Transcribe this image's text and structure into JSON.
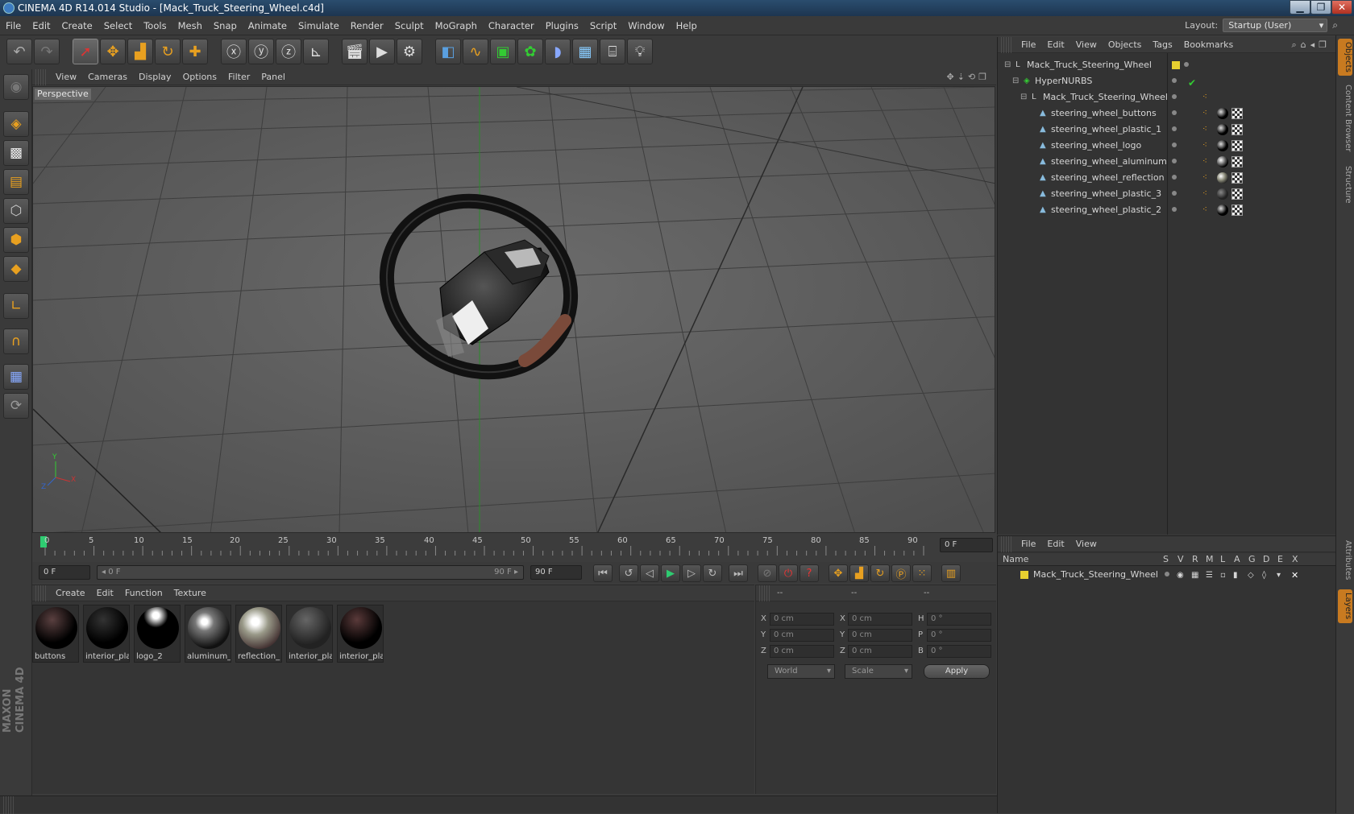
{
  "window": {
    "title": "CINEMA 4D R14.014 Studio - [Mack_Truck_Steering_Wheel.c4d]",
    "min": "▁",
    "max": "❐",
    "close": "✕"
  },
  "menu": [
    "File",
    "Edit",
    "Create",
    "Select",
    "Tools",
    "Mesh",
    "Snap",
    "Animate",
    "Simulate",
    "Render",
    "Sculpt",
    "MoGraph",
    "Character",
    "Plugins",
    "Script",
    "Window",
    "Help"
  ],
  "layout": {
    "label": "Layout:",
    "value": "Startup (User)"
  },
  "viewport": {
    "menu": [
      "View",
      "Cameras",
      "Display",
      "Options",
      "Filter",
      "Panel"
    ],
    "label": "Perspective",
    "axis": {
      "y": "Y",
      "x": "X",
      "z": "Z"
    }
  },
  "timeline": {
    "ticks": [
      "0",
      "5",
      "10",
      "15",
      "20",
      "25",
      "30",
      "35",
      "40",
      "45",
      "50",
      "55",
      "60",
      "65",
      "70",
      "75",
      "80",
      "85",
      "90"
    ],
    "current_frame": "0 F",
    "start_field": "0 F",
    "range_start": "◂ 0 F",
    "range_end": "90 F ▸",
    "end_field": "90 F"
  },
  "materials": {
    "menu": [
      "Create",
      "Edit",
      "Function",
      "Texture"
    ],
    "items": [
      {
        "label": "buttons"
      },
      {
        "label": "interior_pla"
      },
      {
        "label": "logo_2"
      },
      {
        "label": "aluminum_"
      },
      {
        "label": "reflection_"
      },
      {
        "label": "interior_pla"
      },
      {
        "label": "interior_pla"
      }
    ]
  },
  "coords": {
    "headers": [
      "--",
      "--",
      "--"
    ],
    "rows": [
      {
        "a": "X",
        "av": "0 cm",
        "b": "X",
        "bv": "0 cm",
        "c": "H",
        "cv": "0 °"
      },
      {
        "a": "Y",
        "av": "0 cm",
        "b": "Y",
        "bv": "0 cm",
        "c": "P",
        "cv": "0 °"
      },
      {
        "a": "Z",
        "av": "0 cm",
        "b": "Z",
        "bv": "0 cm",
        "c": "B",
        "cv": "0 °"
      }
    ],
    "mode": "World",
    "type": "Scale",
    "apply": "Apply"
  },
  "objects": {
    "menu": [
      "File",
      "Edit",
      "View",
      "Objects",
      "Tags",
      "Bookmarks"
    ],
    "items": [
      {
        "name": "Mack_Truck_Steering_Wheel"
      },
      {
        "name": "HyperNURBS"
      },
      {
        "name": "Mack_Truck_Steering_Wheel"
      },
      {
        "name": "steering_wheel_buttons"
      },
      {
        "name": "steering_wheel_plastic_1"
      },
      {
        "name": "steering_wheel_logo"
      },
      {
        "name": "steering_wheel_aluminum"
      },
      {
        "name": "steering_wheel_reflection"
      },
      {
        "name": "steering_wheel_plastic_3"
      },
      {
        "name": "steering_wheel_plastic_2"
      }
    ]
  },
  "layers": {
    "menu": [
      "File",
      "Edit",
      "View"
    ],
    "name_header": "Name",
    "cols": [
      "S",
      "V",
      "R",
      "M",
      "L",
      "A",
      "G",
      "D",
      "E",
      "X"
    ],
    "item": "Mack_Truck_Steering_Wheel"
  },
  "sidetabs": [
    "Objects",
    "Content Browser",
    "Structure",
    "Attributes",
    "Layers"
  ],
  "brand": "MAXON CINEMA 4D",
  "colors": {
    "accent": "#e8a020",
    "layer_yellow": "#e8d030",
    "steering_grip": "#7a4a3a"
  }
}
